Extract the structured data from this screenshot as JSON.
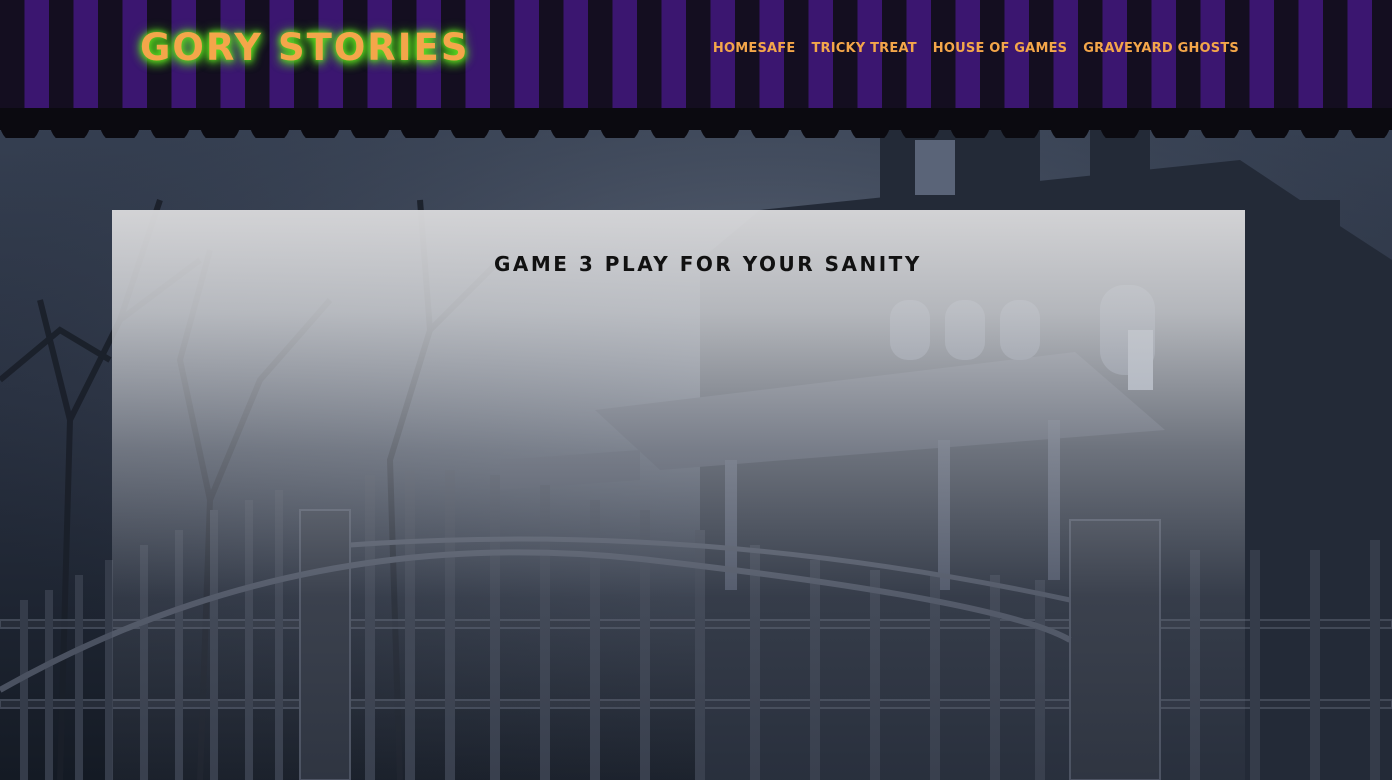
{
  "site": {
    "logo": "GORY STORIES"
  },
  "nav": {
    "items": [
      {
        "label": "HOMESAFE"
      },
      {
        "label": "TRICKY TREAT"
      },
      {
        "label": "HOUSE OF GAMES"
      },
      {
        "label": "GRAVEYARD GHOSTS"
      }
    ]
  },
  "main": {
    "title": "GAME 3 PLAY FOR YOUR SANITY"
  },
  "colors": {
    "header_stripe_dark": "#140e20",
    "header_stripe_purple": "#3b1670",
    "accent_orange": "#f4a64a",
    "logo_glow_green": "#4fd31a"
  }
}
